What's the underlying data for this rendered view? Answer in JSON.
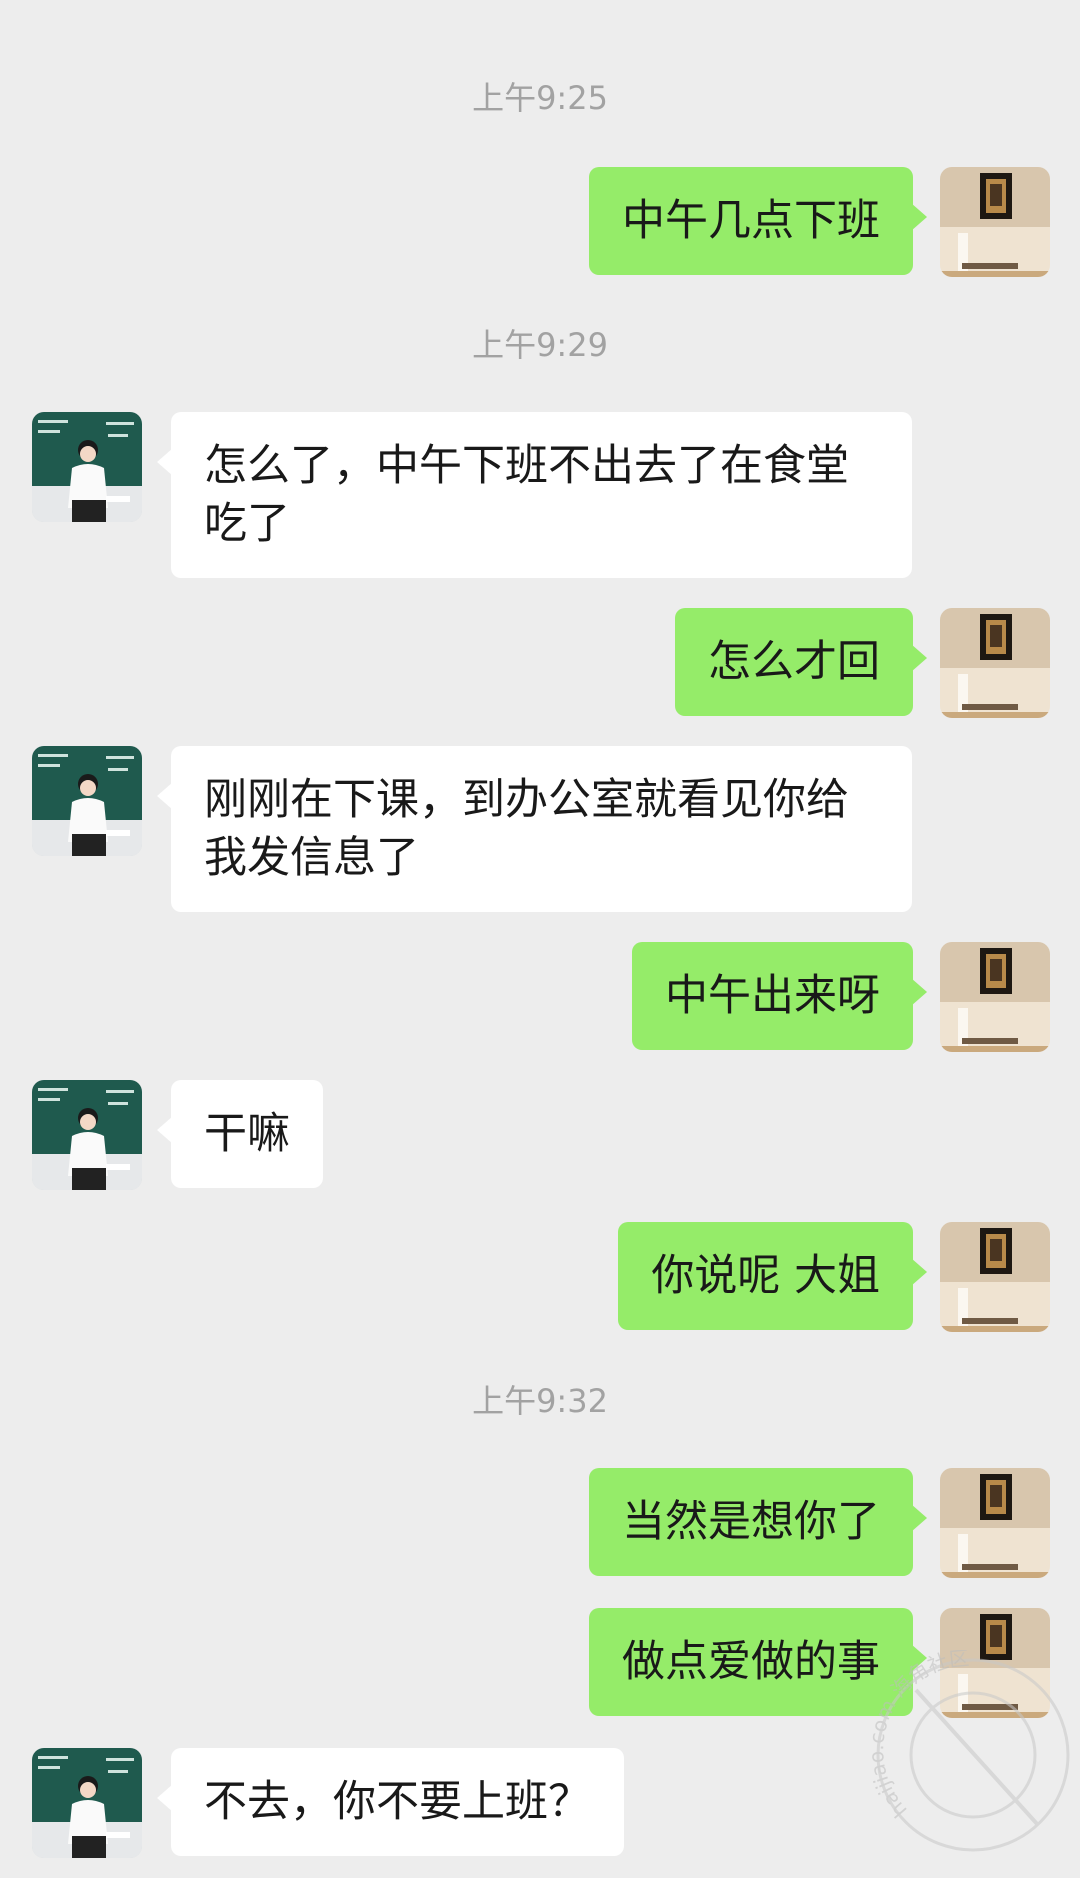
{
  "chat": {
    "messages": [
      {
        "type": "time",
        "text": "上午9:25"
      },
      {
        "type": "out",
        "text": "中午几点下班"
      },
      {
        "type": "time",
        "text": "上午9:29"
      },
      {
        "type": "in",
        "text": "怎么了，中午下班不出去了在食堂吃了"
      },
      {
        "type": "out",
        "text": "怎么才回"
      },
      {
        "type": "in",
        "text": "刚刚在下课，到办公室就看见你给我发信息了"
      },
      {
        "type": "out",
        "text": "中午出来呀"
      },
      {
        "type": "in",
        "text": "干嘛"
      },
      {
        "type": "out",
        "text": "你说呢 大姐"
      },
      {
        "type": "time",
        "text": "上午9:32"
      },
      {
        "type": "out",
        "text": "当然是想你了"
      },
      {
        "type": "out",
        "text": "做点爱做的事"
      },
      {
        "type": "in",
        "text": "不去，你不要上班？"
      }
    ]
  },
  "watermark": {
    "site_name": "海角社区",
    "domain": "haijiao.com"
  },
  "colors": {
    "background": "#ededed",
    "outgoing_bubble": "#95ec69",
    "incoming_bubble": "#ffffff",
    "timestamp": "#a2a2a2"
  },
  "icons": {
    "self_avatar": "framed-picture-avatar",
    "contact_avatar": "teacher-at-blackboard-avatar"
  }
}
